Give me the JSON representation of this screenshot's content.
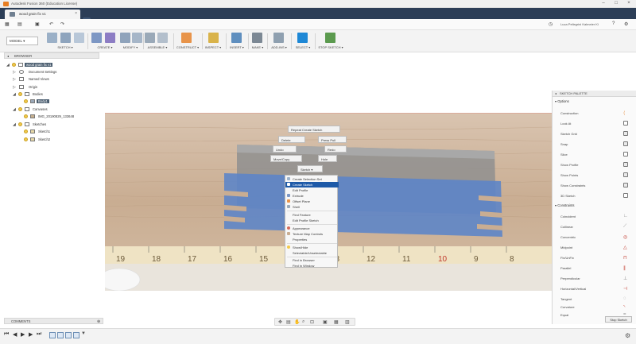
{
  "window": {
    "title": "Autodesk Fusion 360 (Education License)"
  },
  "tabs": [
    {
      "label": "wood grain fix v1"
    }
  ],
  "user": {
    "name": "Luca Pellegrini Kalmeier Ki"
  },
  "toolbar": {
    "mode": "MODEL ▾",
    "groups": [
      "SKETCH ▾",
      "CREATE ▾",
      "MODIFY ▾",
      "ASSEMBLE ▾",
      "CONSTRUCT ▾",
      "INSPECT ▾",
      "INSERT ▾",
      "MAKE ▾",
      "ADD-INS ▾",
      "SELECT ▾",
      "STOP SKETCH ▾"
    ]
  },
  "browser": {
    "title": "BROWSER",
    "items": [
      {
        "label": "wood grain fix v1",
        "highlight": true
      },
      {
        "label": "Document Settings"
      },
      {
        "label": "Named Views"
      },
      {
        "label": "Origin"
      },
      {
        "label": "Bodies"
      },
      {
        "label": "Body1",
        "highlight": true
      },
      {
        "label": "Canvases"
      },
      {
        "label": "IMG_20190829_133648"
      },
      {
        "label": "Sketches"
      },
      {
        "label": "Sketch1"
      },
      {
        "label": "Sketch2"
      }
    ]
  },
  "canvas": {
    "ruler_numbers": [
      "19",
      "18",
      "17",
      "16",
      "15",
      "14",
      "13",
      "12",
      "11",
      "10",
      "9",
      "8"
    ],
    "viewcube": "RIGHT"
  },
  "context": {
    "floating": [
      "Repeat Create Sketch",
      "Delete",
      "Press Pull",
      "Undo",
      "Redo",
      "Move/Copy",
      "Hole",
      "Sketch ▾"
    ],
    "menu": [
      {
        "label": "Create Selection Set"
      },
      {
        "label": "Create Sketch",
        "selected": true
      },
      {
        "label": "Edit Profile"
      },
      {
        "label": "Extrude"
      },
      {
        "label": "Offset Plane"
      },
      {
        "label": "Shell"
      },
      {
        "label": "Find Feature"
      },
      {
        "label": "Edit Profile Sketch"
      },
      {
        "label": "Appearance"
      },
      {
        "label": "Texture Map Controls"
      },
      {
        "label": "Properties"
      },
      {
        "label": "Show/Hide"
      },
      {
        "label": "Selectable/Unselectable"
      },
      {
        "label": "Find in Browser"
      },
      {
        "label": "Find in Window"
      }
    ]
  },
  "palette": {
    "title": "SKETCH PALETTE",
    "options_header": "Options",
    "options": [
      "Construction",
      "Look At",
      "Sketch Grid",
      "Snap",
      "Slice",
      "Show Profile",
      "Show Points",
      "Show Constraints",
      "3D Sketch"
    ],
    "constraints_header": "Constraints",
    "constraints": [
      "Coincident",
      "Collinear",
      "Concentric",
      "Midpoint",
      "Fix/UnFix",
      "Parallel",
      "Perpendicular",
      "Horizontal/Vertical",
      "Tangent",
      "Curvature",
      "Equal"
    ],
    "stop_button": "Stop Sketch"
  },
  "comments": {
    "label": "COMMENTS"
  },
  "colors": {
    "accent": "#1e5aa8",
    "tabbar": "#2c3e57",
    "selection": "#5b84c8"
  }
}
